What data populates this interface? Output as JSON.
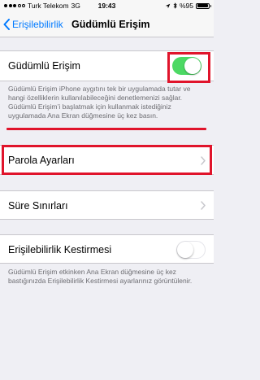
{
  "status_bar": {
    "carrier": "Turk Telekom",
    "network": "3G",
    "time": "19:43",
    "battery_percent": "%95",
    "battery_level": 0.95
  },
  "nav": {
    "back_label": "Erişilebilirlik",
    "title": "Güdümlü Erişim"
  },
  "guided_access": {
    "label": "Güdümlü Erişim",
    "enabled": true,
    "footer": "Güdümlü Erişim iPhone aygıtını tek bir uygulamada tutar ve hangi özelliklerin kullanılabileceğini denetlemenizi sağlar. Güdümlü Erişim’i başlatmak için kullanmak istediğiniz uygulamada Ana Ekran düğmesine üç kez basın."
  },
  "passcode_settings": {
    "label": "Parola Ayarları"
  },
  "time_limits": {
    "label": "Süre Sınırları"
  },
  "accessibility_shortcut": {
    "label": "Erişilebilirlik Kestirmesi",
    "enabled": false,
    "footer": "Güdümlü Erişim etkinken Ana Ekran düğmesine üç kez bastığınızda Erişilebilirlik Kestirmesi ayarlarınız görüntülenir."
  },
  "colors": {
    "accent": "#007aff",
    "toggle_on": "#4cd964",
    "highlight": "#e0142b",
    "background": "#efeff4"
  }
}
